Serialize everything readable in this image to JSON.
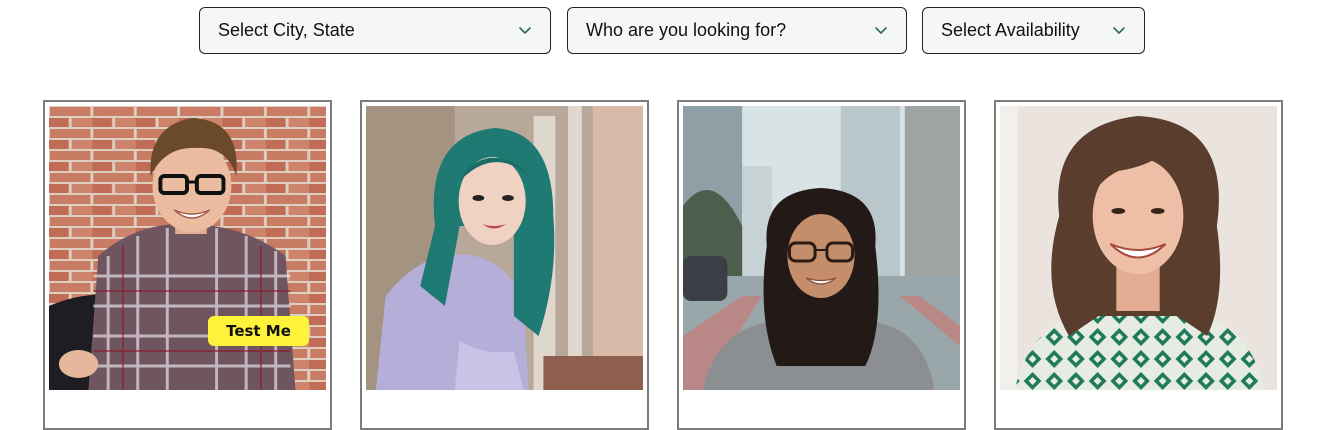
{
  "filters": {
    "city": {
      "label": "Select City, State",
      "icon": "chevron-down-icon"
    },
    "looking_for": {
      "label": "Who are you looking for?",
      "icon": "chevron-down-icon"
    },
    "availability": {
      "label": "Select Availability",
      "icon": "chevron-down-icon"
    }
  },
  "profiles": [
    {
      "test_button_label": "Test Me"
    },
    {},
    {},
    {}
  ],
  "colors": {
    "accent_yellow": "#fff23a",
    "chevron": "#2f6b5a",
    "card_border": "#7c7c7c",
    "select_bg": "#f5f6f7"
  }
}
